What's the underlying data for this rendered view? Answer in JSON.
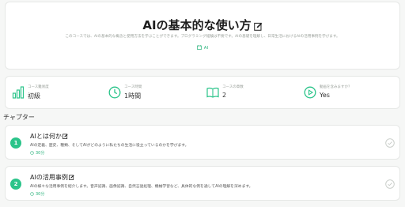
{
  "course": {
    "title": "AIの基本的な使い方",
    "description": "このコースでは、AIの基本的な概念と使用方法を学ぶことができます。プログラミング経験は不要です。AIの基礎を理解し、日常生活におけるAIの活用事例を学びます。",
    "tag": "AI"
  },
  "stats": [
    {
      "icon": "bar-chart-icon",
      "label": "コース難易度",
      "value": "初級"
    },
    {
      "icon": "clock-icon",
      "label": "コース時間",
      "value": "1時間"
    },
    {
      "icon": "book-icon",
      "label": "コースの章数",
      "value": "2"
    },
    {
      "icon": "play-circle-icon",
      "label": "動画を含みますか？",
      "value": "Yes"
    }
  ],
  "chapters_heading": "チャプター",
  "chapters": [
    {
      "number": "1",
      "title": "AIとは何か",
      "description": "AIの定義、歴史、種類、そしてAIがどのように私たちの生活に役立っているのかを学びます。",
      "duration": "30分"
    },
    {
      "number": "2",
      "title": "AIの活用事例",
      "description": "AIの様々な活用事例を紹介します。音声認識、画像認識、自然言語処理、機械学習など、具体的な例を通してAIの理解を深めます。",
      "duration": "30分"
    }
  ],
  "colors": {
    "accent": "#2bc48a",
    "accent_text": "#27b27a",
    "muted": "#9aa09a"
  }
}
